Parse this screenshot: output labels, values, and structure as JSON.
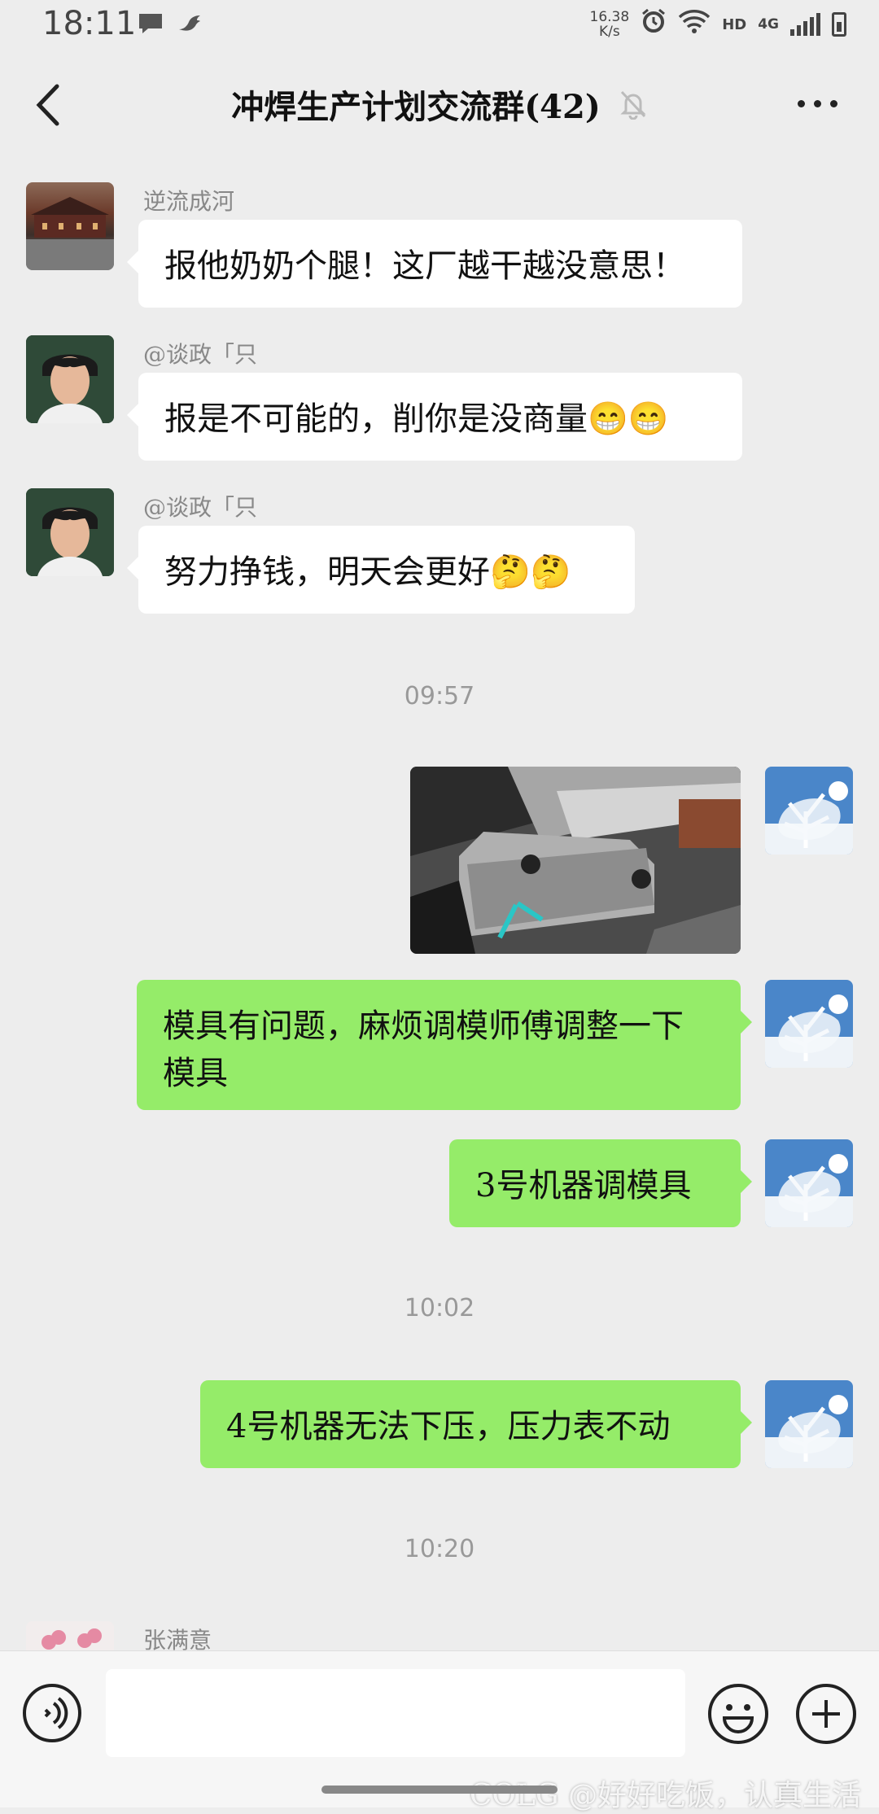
{
  "status_bar": {
    "time": "18:11",
    "net_speed_value": "16.38",
    "net_speed_unit": "K/s",
    "hd": "HD",
    "network": "4G",
    "icons": [
      "message-icon",
      "bird-icon",
      "alarm-icon",
      "wifi-icon",
      "signal-icon",
      "battery-charging-icon"
    ]
  },
  "header": {
    "title": "冲焊生产计划交流群(42)",
    "back_icon": "chevron-left-icon",
    "mute_icon": "bell-off-icon",
    "more_icon": "more-dots-icon"
  },
  "messages": [
    {
      "side": "left",
      "sender": "逆流成河",
      "text": "报他奶奶个腿！这厂越干越没意思！"
    },
    {
      "side": "left",
      "sender": "@谈政「只",
      "text": "报是不可能的，削你是没商量😁😁"
    },
    {
      "side": "left",
      "sender": "@谈政「只",
      "text": "努力挣钱，明天会更好🤔🤔"
    },
    {
      "timestamp": "09:57"
    },
    {
      "side": "right",
      "type": "image",
      "description_icon": "photo-icon"
    },
    {
      "side": "right",
      "text_line1": "模具有问题，麻烦调模师傅调整一下",
      "text_line2": "模具"
    },
    {
      "side": "right",
      "text": "3号机器调模具"
    },
    {
      "timestamp": "10:02"
    },
    {
      "side": "right",
      "text": "4号机器无法下压，压力表不动"
    },
    {
      "timestamp": "10:20"
    },
    {
      "side": "left",
      "sender": "张满意"
    }
  ],
  "input_bar": {
    "placeholder": "",
    "voice_icon": "voice-icon",
    "emoji_icon": "emoji-icon",
    "plus_icon": "plus-icon"
  },
  "watermark": "COLG @好好吃饭，认真生活",
  "colors": {
    "background": "#ededed",
    "bubble_left": "#ffffff",
    "bubble_right": "#95ec69"
  }
}
